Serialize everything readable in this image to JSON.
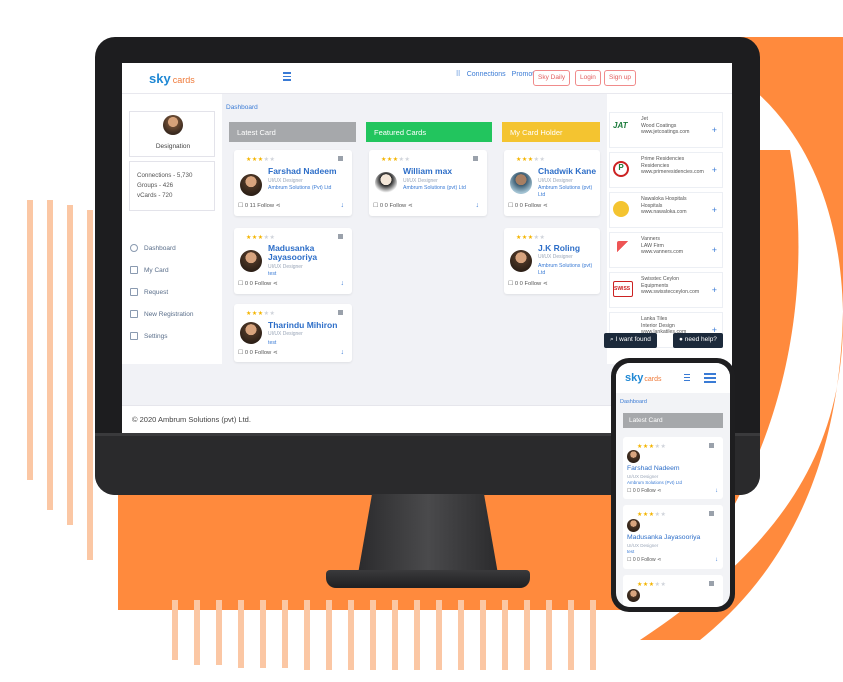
{
  "brand": {
    "logo": "sky",
    "logo_sub": "cards"
  },
  "colors": {
    "accent": "#3a7bd5",
    "orange": "#ff8a3d",
    "green": "#22c55e",
    "gold": "#f4c430",
    "gray": "#a6a8ab"
  },
  "nav": {
    "connections": "Connections",
    "promote": "Promote",
    "sky_daily": "Sky Daily",
    "login": "Login",
    "signup": "Sign up"
  },
  "sidebar": {
    "designation": "Designation",
    "stats": [
      "Connections - 5,730",
      "Groups - 426",
      "vCards - 720"
    ],
    "items": [
      {
        "label": "Dashboard",
        "icon": "dashboard-icon"
      },
      {
        "label": "My Card",
        "icon": "grid-icon"
      },
      {
        "label": "Request",
        "icon": "grid-icon"
      },
      {
        "label": "New Registration",
        "icon": "grid-icon"
      },
      {
        "label": "Settings",
        "icon": "grid-icon"
      }
    ]
  },
  "breadcrumb": "Dashboard",
  "columns": {
    "latest": "Latest Card",
    "featured": "Featured Cards",
    "holder": "My Card Holder"
  },
  "cards": {
    "c1": {
      "name": "Farshad Nadeem",
      "role": "UI/UX Designer",
      "company": "Ambrum Solutions (Pvt) Ltd",
      "follow": "0  11  Follow"
    },
    "c2": {
      "name": "Madusanka Jayasooriya",
      "role": "UI/UX Designer",
      "company": "test",
      "follow": "0  0  Follow"
    },
    "c3": {
      "name": "Tharindu Mihiron",
      "role": "UI/UX Designer",
      "company": "test",
      "follow": "0  0  Follow"
    },
    "c4": {
      "name": "William max",
      "role": "UI/UX Designer",
      "company": "Ambrum Solutions (pvt) Ltd",
      "follow": "0  0  Follow"
    },
    "c5": {
      "name": "Chadwik Kane",
      "role": "UI/UX Designer",
      "company": "Ambrum Solutions (pvt) Ltd",
      "follow": "0  0  Follow"
    },
    "c6": {
      "name": "J.K Roling",
      "role": "UI/UX Designer",
      "company": "Ambrum Solutions (pvt) Ltd",
      "follow": "0  0  Follow"
    }
  },
  "businesses": [
    {
      "l1": "Jet",
      "l2": "Wood Coatings",
      "l3": "www.jetcoatings.com",
      "logo": "JAT"
    },
    {
      "l1": "Prime Residencies",
      "l2": "Residencies",
      "l3": "www.primeresidencies.com",
      "logo": "P"
    },
    {
      "l1": "Nawaloka Hospitals",
      "l2": "Hospitals",
      "l3": "www.nawaloka.com",
      "logo": ""
    },
    {
      "l1": "Vanners",
      "l2": "LAW Firm",
      "l3": "www.vanners.com",
      "logo": ""
    },
    {
      "l1": "Swisstec Ceylon",
      "l2": "Equipments",
      "l3": "www.swisstecceylon.com",
      "logo": "SWISS"
    },
    {
      "l1": "Lanka Tiles",
      "l2": "Interior Design",
      "l3": "www.lankatiles.com",
      "logo": ""
    }
  ],
  "help": {
    "found": "I want found",
    "need": "need help?"
  },
  "footer": "© 2020 Ambrum Solutions (pvt) Ltd.",
  "phone": {
    "breadcrumb": "Dashboard",
    "head": "Latest Card",
    "cards": [
      {
        "name": "Farshad Nadeem",
        "role": "UI/UX Designer",
        "company": "Ambrum Solutions (Pvt) Ltd",
        "follow": "0  0  Follow"
      },
      {
        "name": "Madusanka Jayasooriya",
        "role": "UI/UX Designer",
        "company": "test",
        "follow": "0  0  Follow"
      }
    ]
  }
}
